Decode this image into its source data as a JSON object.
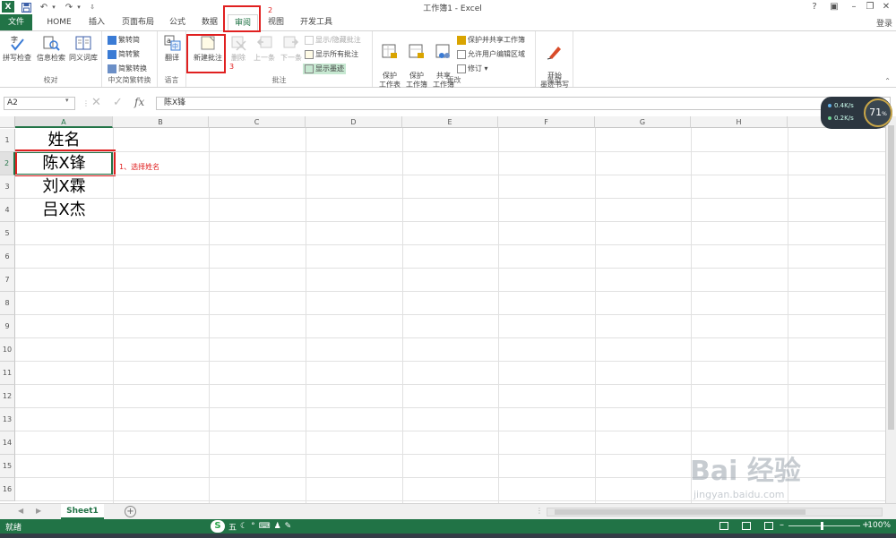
{
  "window": {
    "title": "工作簿1 - Excel",
    "app_icon": "excel-icon",
    "login": "登录"
  },
  "tabs": [
    {
      "label": "文件"
    },
    {
      "label": "HOME"
    },
    {
      "label": "插入"
    },
    {
      "label": "页面布局"
    },
    {
      "label": "公式"
    },
    {
      "label": "数据"
    },
    {
      "label": "审阅",
      "active": true
    },
    {
      "label": "视图"
    },
    {
      "label": "开发工具"
    }
  ],
  "ribbon": {
    "groups": {
      "proofing": {
        "label": "校对",
        "spell": "拼写检查",
        "research": "信息检索",
        "thesaurus": "同义词库"
      },
      "chinese": {
        "label": "中文简繁转换",
        "to_simplified": "繁转简",
        "to_traditional": "简转繁",
        "convert": "简繁转换"
      },
      "language": {
        "label": "语言",
        "translate": "翻译"
      },
      "comments": {
        "label": "批注",
        "new": "新建批注",
        "delete": "删除",
        "prev": "上一条",
        "next": "下一条",
        "show_hide": "显示/隐藏批注",
        "show_all": "显示所有批注",
        "show_ink": "显示墨迹"
      },
      "changes": {
        "label": "更改",
        "protect_sheet": "保护\n工作表",
        "protect_workbook": "保护\n工作簿",
        "share_workbook": "共享\n工作簿",
        "protect_share": "保护并共享工作簿",
        "allow_edit": "允许用户编辑区域",
        "track": "修订"
      },
      "ink": {
        "label": "墨迹",
        "start_inking": "开始\n墨迹书写"
      }
    }
  },
  "formula_bar": {
    "name_box": "A2",
    "fx": "fx",
    "content": "陈X锋"
  },
  "columns": [
    "A",
    "B",
    "C",
    "D",
    "E",
    "F",
    "G",
    "H"
  ],
  "rows": [
    "1",
    "2",
    "3",
    "4",
    "5",
    "6",
    "7",
    "8",
    "9",
    "10",
    "11",
    "12",
    "13",
    "14",
    "15",
    "16"
  ],
  "cells": {
    "A1": "姓名",
    "A2": "陈X锋",
    "A3": "刘X霖",
    "A4": "吕X杰"
  },
  "annotations": {
    "step1": "1、选择姓名",
    "step2": "2",
    "step3": "3"
  },
  "sheets": [
    {
      "name": "Sheet1"
    }
  ],
  "status": {
    "ready": "就绪",
    "zoom": "100%",
    "ime": [
      "五",
      "°",
      "⌨"
    ]
  },
  "net_widget": {
    "up": "0.4K/s",
    "down": "0.2K/s",
    "percent": "71",
    "unit": "%"
  },
  "watermark": {
    "text": "Bai 经验",
    "url": "jingyan.baidu.com"
  },
  "colors": {
    "excel_green": "#217346",
    "annotation_red": "#e02020",
    "status_bar": "#217346"
  }
}
